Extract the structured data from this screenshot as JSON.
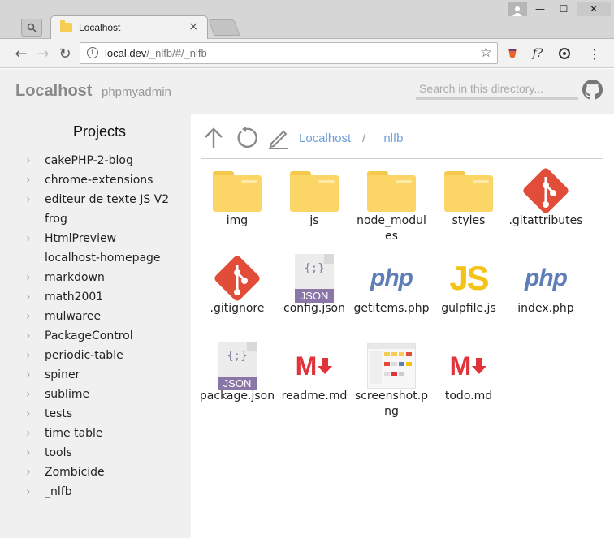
{
  "browser": {
    "tab_title": "Localhost",
    "tab_close": "×",
    "url_host": "local.dev",
    "url_path": "/_nlfb/#/_nlfb",
    "back_glyph": "←",
    "forward_glyph": "→",
    "reload_glyph": "↻",
    "star_glyph": "☆",
    "menu_glyph": "⋮",
    "minimize_glyph": "—",
    "maximize_glyph": "☐",
    "close_glyph": "✕",
    "ext_f_label": "f?"
  },
  "header": {
    "brand": "Localhost",
    "sublink": "phpmyadmin",
    "search_placeholder": "Search in this directory..."
  },
  "sidebar": {
    "title": "Projects",
    "items": [
      {
        "label": "cakePHP-2-blog",
        "expandable": true
      },
      {
        "label": "chrome-extensions",
        "expandable": true
      },
      {
        "label": "editeur de texte JS V2",
        "expandable": true
      },
      {
        "label": "frog",
        "expandable": false
      },
      {
        "label": "HtmlPreview",
        "expandable": true
      },
      {
        "label": "localhost-homepage",
        "expandable": false
      },
      {
        "label": "markdown",
        "expandable": true
      },
      {
        "label": "math2001",
        "expandable": true
      },
      {
        "label": "mulwaree",
        "expandable": true
      },
      {
        "label": "PackageControl",
        "expandable": true
      },
      {
        "label": "periodic-table",
        "expandable": true
      },
      {
        "label": "spiner",
        "expandable": true
      },
      {
        "label": "sublime",
        "expandable": true
      },
      {
        "label": "tests",
        "expandable": true
      },
      {
        "label": "time table",
        "expandable": true
      },
      {
        "label": "tools",
        "expandable": true
      },
      {
        "label": "Zombicide",
        "expandable": true
      },
      {
        "label": "_nlfb",
        "expandable": true
      }
    ]
  },
  "breadcrumb": {
    "items": [
      "Localhost",
      "_nlfb"
    ],
    "separator": "/"
  },
  "files": [
    {
      "name": "img",
      "icon": "folder"
    },
    {
      "name": "js",
      "icon": "folder"
    },
    {
      "name": "node_modules",
      "icon": "folder"
    },
    {
      "name": "styles",
      "icon": "folder"
    },
    {
      "name": ".gitattributes",
      "icon": "git"
    },
    {
      "name": ".gitignore",
      "icon": "git"
    },
    {
      "name": "config.json",
      "icon": "json"
    },
    {
      "name": "getitems.php",
      "icon": "php"
    },
    {
      "name": "gulpfile.js",
      "icon": "js"
    },
    {
      "name": "index.php",
      "icon": "php"
    },
    {
      "name": "package.json",
      "icon": "json"
    },
    {
      "name": "readme.md",
      "icon": "markdown"
    },
    {
      "name": "screenshot.png",
      "icon": "image"
    },
    {
      "name": "todo.md",
      "icon": "markdown"
    }
  ],
  "icon_text": {
    "json_tag": "JSON",
    "json_braces": "{;}",
    "php": "php",
    "js": "JS",
    "md_m": "M"
  },
  "colors": {
    "folder": "#fbd666",
    "git": "#e24d3a",
    "json": "#8a77a8",
    "php": "#5f7eb7",
    "js": "#f4c315",
    "markdown": "#e0333a",
    "link": "#6f9fd8"
  }
}
